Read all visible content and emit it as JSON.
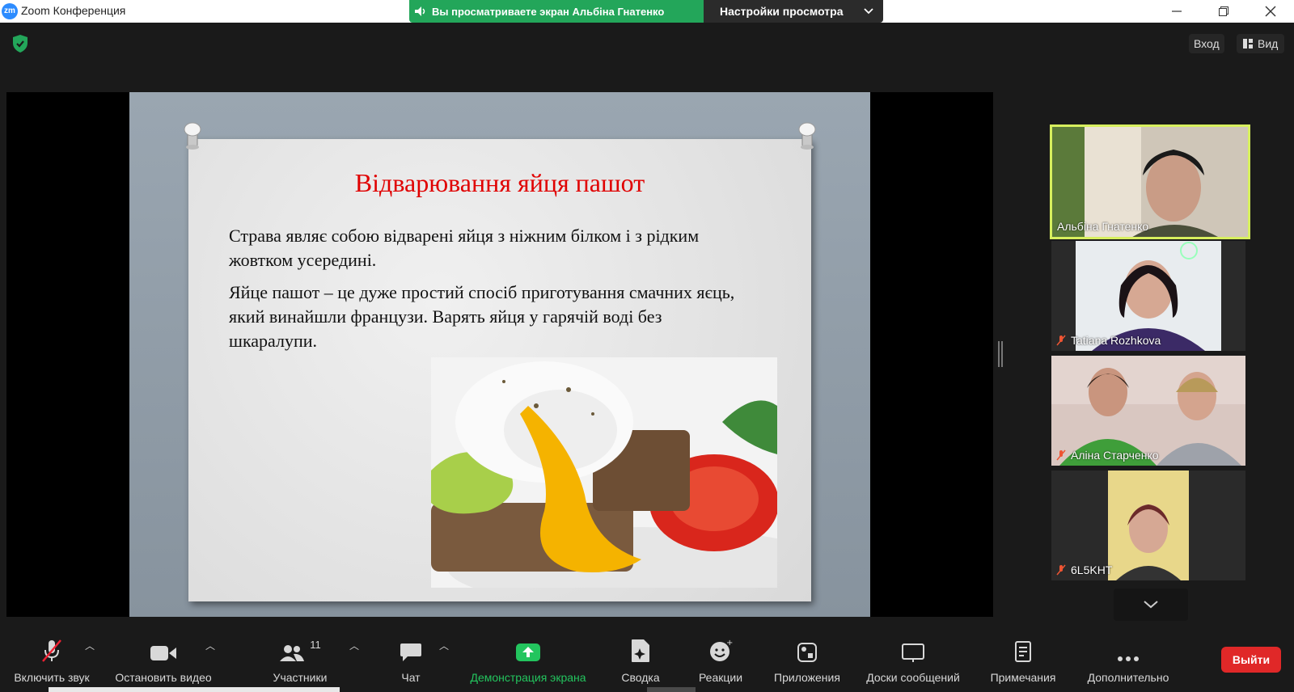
{
  "window": {
    "app_logo": "zm",
    "title": "Zoom Конференция"
  },
  "share_banner": {
    "status": "Вы просматриваете экран Альбіна Гнатенко",
    "view_options": "Настройки просмотра"
  },
  "topbar": {
    "login": "Вход",
    "view": "Вид"
  },
  "slide": {
    "title": "Відварювання яйця пашот",
    "paragraph1": "Страва являє собою відварені яйця з ніжним білком і з рідким жовтком усередині.",
    "paragraph2": "Яйце пашот – це дуже простий спосіб приготування смачних яєць, який винайшли французи. Варять яйця у гарячій воді без шкаралупи."
  },
  "participants": [
    {
      "name": "Альбіна Гнатенко",
      "muted": false,
      "active_speaker": true
    },
    {
      "name": "Tatiana Rozhkova",
      "muted": true
    },
    {
      "name": "Аліна Старченко",
      "muted": true
    },
    {
      "name": "6L5KHT",
      "muted": true
    }
  ],
  "toolbar": {
    "audio": "Включить звук",
    "video": "Остановить видео",
    "participants": "Участники",
    "participants_count": "11",
    "chat": "Чат",
    "share": "Демонстрация экрана",
    "summary": "Сводка",
    "reactions": "Реакции",
    "apps": "Приложения",
    "whiteboards": "Доски сообщений",
    "notes": "Примечания",
    "more": "Дополнительно",
    "leave": "Выйти"
  },
  "colors": {
    "share_green": "#23A65A",
    "leave_red": "#E02828",
    "active_border": "#D7EF5E",
    "slide_title": "#E00000"
  },
  "icons": [
    "shield-icon",
    "speaker-icon",
    "chevron-down-icon",
    "minimize-icon",
    "restore-icon",
    "close-icon",
    "grid-icon",
    "mic-muted-icon",
    "video-icon",
    "participants-icon",
    "chat-icon",
    "share-up-icon",
    "summary-icon",
    "reaction-icon",
    "apps-icon",
    "whiteboard-icon",
    "notes-icon",
    "more-icon"
  ]
}
